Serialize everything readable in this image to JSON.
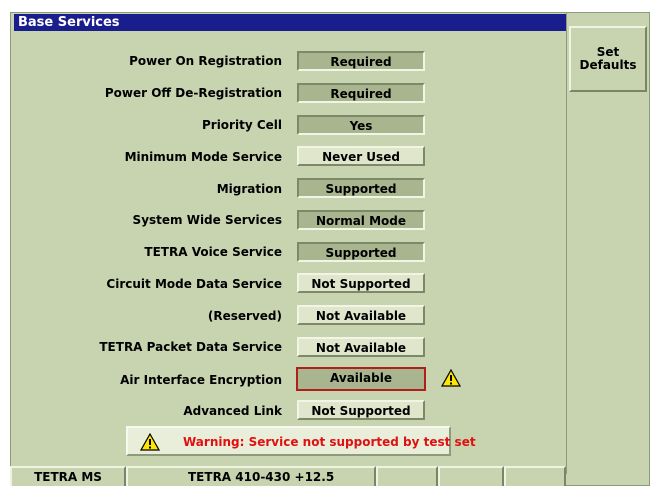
{
  "window": {
    "title": "Base Services"
  },
  "softkeys": {
    "set_defaults": "Set\nDefaults"
  },
  "rows": [
    {
      "label": "Power On Registration",
      "value": "Required"
    },
    {
      "label": "Power Off De-Registration",
      "value": "Required"
    },
    {
      "label": "Priority Cell",
      "value": "Yes"
    },
    {
      "label": "Minimum Mode Service",
      "value": "Never Used"
    },
    {
      "label": "Migration",
      "value": "Supported"
    },
    {
      "label": "System Wide Services",
      "value": "Normal Mode"
    },
    {
      "label": "TETRA Voice Service",
      "value": "Supported"
    },
    {
      "label": "Circuit Mode Data Service",
      "value": "Not Supported"
    },
    {
      "label": "(Reserved)",
      "value": "Not Available"
    },
    {
      "label": "TETRA Packet Data Service",
      "value": "Not Available"
    },
    {
      "label": "Air Interface Encryption",
      "value": "Available"
    },
    {
      "label": "Advanced Link",
      "value": "Not Supported"
    }
  ],
  "selected_row": "Air Interface Encryption",
  "warning": {
    "text": "Warning: Service not supported by test set",
    "icon": "warning-triangle-icon"
  },
  "status_bar": {
    "mode": "TETRA MS",
    "band": "TETRA 410-430 +12.5"
  },
  "colors": {
    "screen_bg": "#c8d4b0",
    "title_bar": "#1a1e8c",
    "warning_text": "#e01010",
    "selection_border": "#b0201a"
  }
}
